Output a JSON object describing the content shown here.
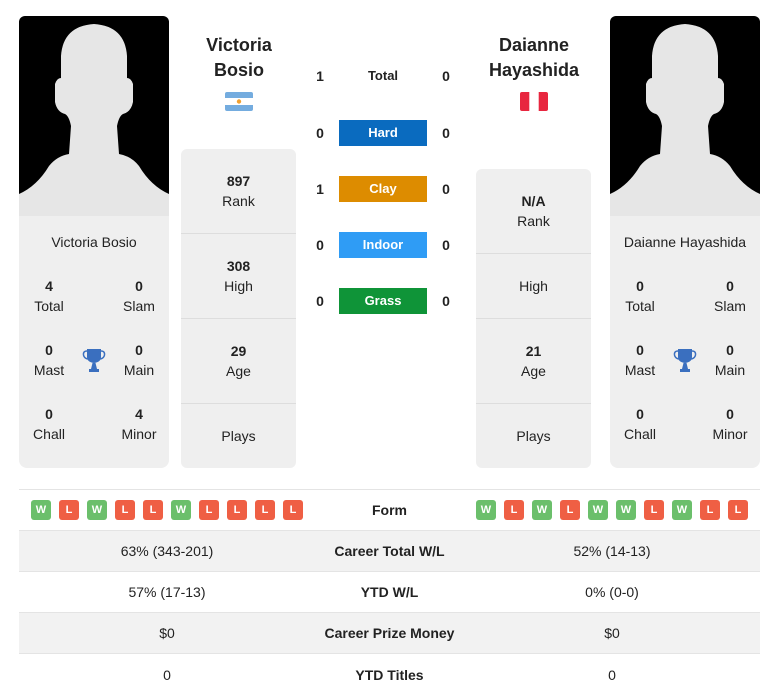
{
  "player1": {
    "name": "Victoria Bosio",
    "name_line1": "Victoria",
    "name_line2": "Bosio",
    "flag": "argentina-flag",
    "titles": {
      "total": "4",
      "slam": "0",
      "mast": "0",
      "main": "0",
      "chall": "0",
      "minor": "4"
    },
    "stats": {
      "rank": "897",
      "high": "308",
      "age": "29",
      "plays": ""
    },
    "form": [
      "W",
      "L",
      "W",
      "L",
      "L",
      "W",
      "L",
      "L",
      "L",
      "L"
    ]
  },
  "player2": {
    "name": "Daianne Hayashida",
    "name_line1": "Daianne",
    "name_line2": "Hayashida",
    "flag": "peru-flag",
    "titles": {
      "total": "0",
      "slam": "0",
      "mast": "0",
      "main": "0",
      "chall": "0",
      "minor": "0"
    },
    "stats": {
      "rank": "N/A",
      "high": "",
      "age": "21",
      "plays": ""
    },
    "form": [
      "W",
      "L",
      "W",
      "L",
      "W",
      "W",
      "L",
      "W",
      "L",
      "L"
    ]
  },
  "labels": {
    "total": "Total",
    "slam": "Slam",
    "mast": "Mast",
    "main": "Main",
    "chall": "Chall",
    "minor": "Minor",
    "rank": "Rank",
    "high": "High",
    "age": "Age",
    "plays": "Plays"
  },
  "h2h": [
    {
      "surface": "Total",
      "p1": "1",
      "p2": "0",
      "color": ""
    },
    {
      "surface": "Hard",
      "p1": "0",
      "p2": "0",
      "color": "#0a6bbf"
    },
    {
      "surface": "Clay",
      "p1": "1",
      "p2": "0",
      "color": "#dd8c00"
    },
    {
      "surface": "Indoor",
      "p1": "0",
      "p2": "0",
      "color": "#2f9cf5"
    },
    {
      "surface": "Grass",
      "p1": "0",
      "p2": "0",
      "color": "#0f9438"
    }
  ],
  "table": {
    "form_label": "Form",
    "rows": [
      {
        "label": "Career Total W/L",
        "p1": "63% (343-201)",
        "p2": "52% (14-13)"
      },
      {
        "label": "YTD W/L",
        "p1": "57% (17-13)",
        "p2": "0% (0-0)"
      },
      {
        "label": "Career Prize Money",
        "p1": "$0",
        "p2": "$0"
      },
      {
        "label": "YTD Titles",
        "p1": "0",
        "p2": "0"
      }
    ]
  }
}
